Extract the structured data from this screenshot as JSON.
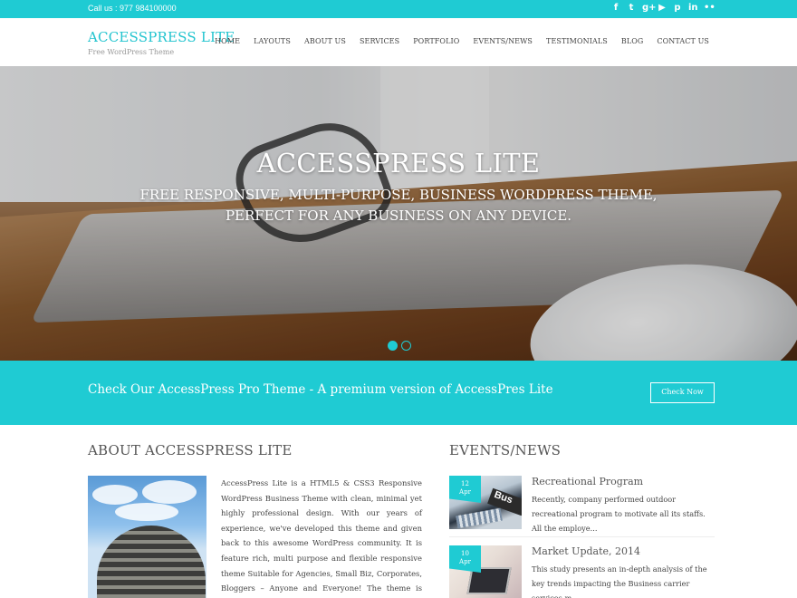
{
  "topbar": {
    "phone": "Call us : 977 984100000",
    "socials": [
      {
        "icon": "facebook-icon",
        "glyph": "f"
      },
      {
        "icon": "twitter-icon",
        "glyph": "t"
      },
      {
        "icon": "googleplus-icon",
        "glyph": "g+"
      },
      {
        "icon": "youtube-icon",
        "glyph": "▶"
      },
      {
        "icon": "pinterest-icon",
        "glyph": "p"
      },
      {
        "icon": "linkedin-icon",
        "glyph": "in"
      },
      {
        "icon": "flickr-icon",
        "glyph": "••"
      }
    ]
  },
  "header": {
    "site_title": "ACCESSPRESS LITE",
    "tagline": "Free WordPress Theme",
    "nav": [
      "HOME",
      "LAYOUTS",
      "ABOUT US",
      "SERVICES",
      "PORTFOLIO",
      "EVENTS/NEWS",
      "TESTIMONIALS",
      "BLOG",
      "CONTACT US"
    ]
  },
  "hero": {
    "title": "ACCESSPRESS LITE",
    "subtitle": "FREE RESPONSIVE, MULTI-PURPOSE, BUSINESS WORDPRESS THEME, PERFECT FOR ANY BUSINESS ON ANY DEVICE.",
    "slides": 2,
    "active_slide": 1
  },
  "cta": {
    "text": "Check Our AccessPress Pro Theme - A premium version of AccessPres Lite",
    "button": "Check Now"
  },
  "about": {
    "title": "ABOUT ACCESSPRESS LITE",
    "text": "AccessPress Lite is a HTML5 & CSS3 Responsive WordPress Business Theme with clean, minimal yet highly professional design. With our years of experience, we've developed this theme and given back to this awesome WordPress community. It is feature rich, multi purpose and flexible responsive theme Suitable for Agencies, Small Biz, Corporates, Bloggers – Anyone and Everyone! The theme is complete with many useful"
  },
  "events": {
    "title": "EVENTS/NEWS",
    "items": [
      {
        "day": "12",
        "month": "Apr",
        "title": "Recreational Program",
        "desc": "Recently, company performed outdoor recreational program to motivate all its staffs. All the employe..."
      },
      {
        "day": "10",
        "month": "Apr",
        "title": "Market Update, 2014",
        "desc": "This study presents an in-depth analysis of the key trends impacting the Business carrier services m..."
      }
    ]
  },
  "colors": {
    "accent": "#1fcbd3",
    "text": "#444444"
  }
}
